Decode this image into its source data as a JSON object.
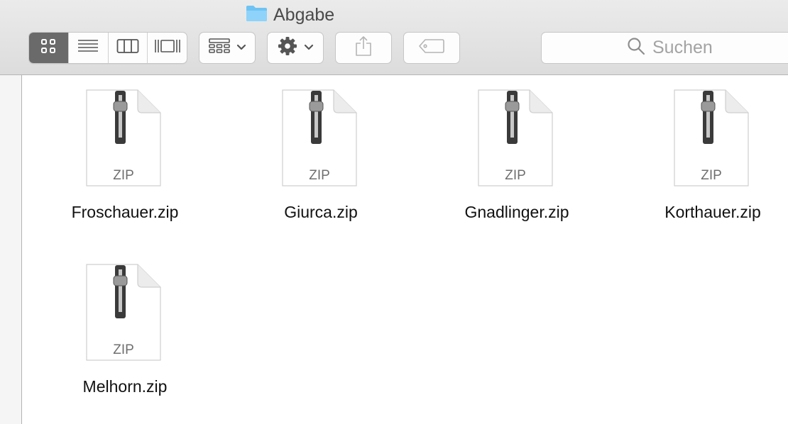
{
  "window": {
    "title": "Abgabe",
    "folder_icon": "folder-icon",
    "folder_color": "#6ec3f4"
  },
  "toolbar": {
    "view_modes": [
      {
        "name": "icon-view",
        "icon": "grid-icon",
        "selected": true
      },
      {
        "name": "list-view",
        "icon": "list-icon",
        "selected": false
      },
      {
        "name": "column-view",
        "icon": "columns-icon",
        "selected": false
      },
      {
        "name": "cover-flow-view",
        "icon": "cover-flow-icon",
        "selected": false
      }
    ],
    "arrange_icon": "arrange-grid-icon",
    "action_icon": "gear-icon",
    "share_icon": "share-icon",
    "tag_icon": "tag-icon"
  },
  "search": {
    "placeholder": "Suchen",
    "icon": "search-icon"
  },
  "files": [
    {
      "name": "Froschauer.zip",
      "type_label": "ZIP"
    },
    {
      "name": "Giurca.zip",
      "type_label": "ZIP"
    },
    {
      "name": "Gnadlinger.zip",
      "type_label": "ZIP"
    },
    {
      "name": "Korthauer.zip",
      "type_label": "ZIP"
    },
    {
      "name": "Melhorn.zip",
      "type_label": "ZIP"
    }
  ],
  "colors": {
    "toolbar_bg": "#e3e3e3",
    "selected_segment": "#6a6a6a",
    "placeholder_text": "#a3a3a3"
  }
}
